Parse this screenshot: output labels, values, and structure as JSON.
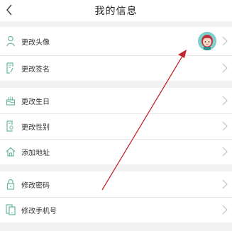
{
  "header": {
    "title": "我的信息",
    "back_icon": "chevron-left-icon"
  },
  "groups": [
    {
      "rows": [
        {
          "label": "更改头像",
          "icon": "person-icon"
        },
        {
          "label": "更改签名",
          "icon": "edit-document-icon"
        }
      ]
    },
    {
      "rows": [
        {
          "label": "更改生日",
          "icon": "cake-icon"
        },
        {
          "label": "更改性别",
          "icon": "gender-icon"
        },
        {
          "label": "添加地址",
          "icon": "home-icon"
        }
      ]
    },
    {
      "rows": [
        {
          "label": "修改密码",
          "icon": "lock-icon"
        },
        {
          "label": "修改手机号",
          "icon": "phone-icon"
        }
      ]
    }
  ],
  "colors": {
    "icon": "#6ab8a0",
    "annotation_arrow": "#c0282e",
    "avatar_bg": "#7fd0cc"
  }
}
